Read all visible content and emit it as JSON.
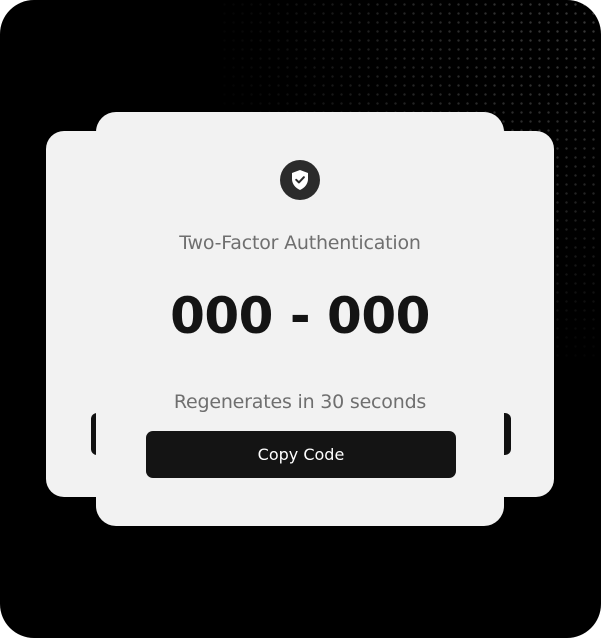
{
  "card": {
    "title": "Two-Factor Authentication",
    "code": "000 - 000",
    "regenerate_text": "Regenerates in 30 seconds",
    "copy_button_label": "Copy Code",
    "icon": "shield-check-icon"
  },
  "colors": {
    "background": "#000000",
    "card": "#f2f2f2",
    "button": "#141414",
    "title_text": "#6f6f6f",
    "code_text": "#141414"
  }
}
